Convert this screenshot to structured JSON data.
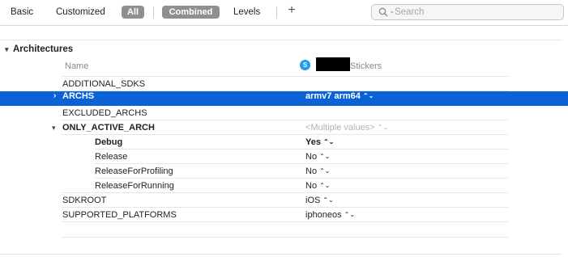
{
  "toolbar": {
    "basic": "Basic",
    "customized": "Customized",
    "all": "All",
    "combined": "Combined",
    "levels": "Levels",
    "add": "+",
    "search_placeholder": "Search"
  },
  "section": {
    "title": "Architectures"
  },
  "columns": {
    "name": "Name",
    "target_name": "Stickers",
    "target_icon_glyph": "S"
  },
  "rows": {
    "additional_sdks": {
      "name": "ADDITIONAL_SDKS",
      "value": ""
    },
    "archs": {
      "name": "ARCHS",
      "value": "armv7 arm64",
      "stepper": "⌃⌄"
    },
    "excluded_archs": {
      "name": "EXCLUDED_ARCHS",
      "value": ""
    },
    "only_active_arch": {
      "name": "ONLY_ACTIVE_ARCH",
      "value": "<Multiple values>",
      "stepper": "⌃⌄"
    },
    "debug": {
      "name": "Debug",
      "value": "Yes",
      "stepper": "⌃⌄"
    },
    "release": {
      "name": "Release",
      "value": "No",
      "stepper": "⌃⌄"
    },
    "release_profiling": {
      "name": "ReleaseForProfiling",
      "value": "No",
      "stepper": "⌃⌄"
    },
    "release_running": {
      "name": "ReleaseForRunning",
      "value": "No",
      "stepper": "⌃⌄"
    },
    "sdkroot": {
      "name": "SDKROOT",
      "value": "iOS",
      "stepper": "⌃⌄"
    },
    "supported_platforms": {
      "name": "SUPPORTED_PLATFORMS",
      "value": "iphoneos",
      "stepper": "⌃⌄"
    }
  },
  "colors": {
    "selection": "#0a63d6",
    "pill": "#8e8e93",
    "target_icon": "#1e9bf0"
  }
}
